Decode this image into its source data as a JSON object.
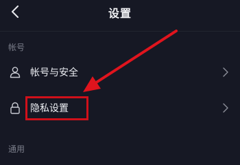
{
  "header": {
    "title": "设置",
    "back_icon": "chevron-left-icon"
  },
  "sections": [
    {
      "title": "帐号",
      "items": [
        {
          "label": "帐号与安全",
          "icon": "user-icon"
        },
        {
          "label": "隐私设置",
          "icon": "lock-icon"
        }
      ]
    },
    {
      "title": "通用",
      "items": []
    }
  ],
  "annotation": {
    "highlight_color": "#d0101a",
    "arrow_color": "#e0141d",
    "target": "隐私设置"
  },
  "colors": {
    "background": "#161824",
    "text": "#eceef3",
    "muted": "#7b7e8a"
  }
}
